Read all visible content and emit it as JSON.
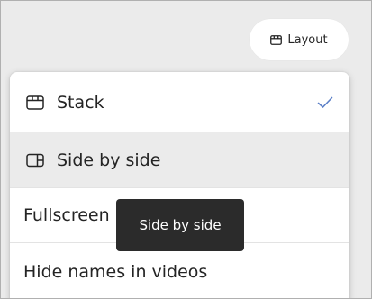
{
  "toolbar": {
    "layout_label": "Layout",
    "layout_icon": "stack-layout-icon"
  },
  "menu": {
    "items": [
      {
        "label": "Stack",
        "icon": "stack-layout-icon",
        "checked": true
      },
      {
        "label": "Side by side",
        "icon": "side-by-side-icon",
        "hovered": true
      },
      {
        "label": "Fullscreen"
      },
      {
        "label": "Hide names in videos"
      }
    ],
    "check_icon": "checkmark-icon"
  },
  "tooltip": {
    "text": "Side by side"
  },
  "colors": {
    "accent": "#5b7fc7",
    "hover_bg": "#ebebeb",
    "tooltip_bg": "#2b2b2b"
  }
}
